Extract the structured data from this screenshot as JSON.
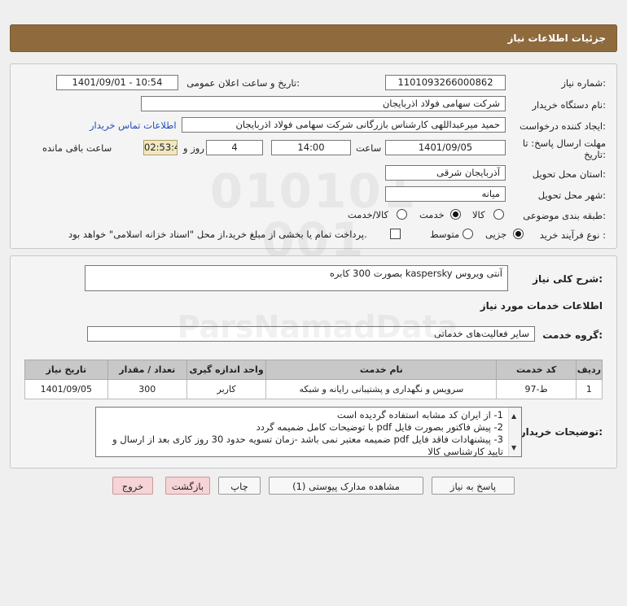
{
  "header": {
    "title": "جزئیات اطلاعات نیاز"
  },
  "form": {
    "need_number_label": "شماره نیاز:",
    "need_number": "1101093266000862",
    "announce_label": "تاریخ و ساعت اعلان عمومی:",
    "announce_value": "1401/09/01 - 10:54",
    "buyer_org_label": "نام دستگاه خریدار:",
    "buyer_org": "شرکت سهامی فولاد اذربایجان",
    "creator_label": "ایجاد کننده درخواست:",
    "creator": "حمید میرعبداللهی کارشناس بازرگانی شرکت سهامی فولاد اذربایجان",
    "contact_link": "اطلاعات تماس خریدار",
    "deadline_label_1": "مهلت ارسال پاسخ: تا",
    "deadline_label_2": "تاریخ:",
    "deadline_date": "1401/09/05",
    "time_label": "ساعت",
    "deadline_time": "14:00",
    "days_value": "4",
    "days_label": "روز و",
    "remaining_time": "02:53:45",
    "remaining_label": "ساعت باقی مانده",
    "province_label": "استان محل تحویل:",
    "province": "آذربایجان شرقی",
    "city_label": "شهر محل تحویل:",
    "city": "میانه",
    "category_label": "طبقه بندی موضوعی:",
    "category_options": [
      "کالا",
      "خدمت",
      "کالا/خدمت"
    ],
    "category_selected": "خدمت",
    "purchase_type_label": "نوع فرآیند خرید :",
    "purchase_options": [
      "جزیی",
      "متوسط"
    ],
    "purchase_selected": "جزیی",
    "treasury_note": "پرداخت تمام یا بخشی از مبلغ خرید،از محل \"اسناد خزانه اسلامی\" خواهد بود."
  },
  "summary": {
    "label": "شرح کلی نیاز:",
    "text": "آنتی ویروس kaspersky بصورت 300 کابره"
  },
  "services": {
    "section_title": "اطلاعات خدمات مورد نیاز",
    "group_label": "گروه خدمت:",
    "group_value": "سایر فعالیت‌های خدماتی",
    "columns": [
      "ردیف",
      "کد خدمت",
      "نام خدمت",
      "واحد اندازه گیری",
      "تعداد / مقدار",
      "تاریخ نیاز"
    ],
    "rows": [
      [
        "1",
        "ط-97",
        "سرویس و نگهداری و پشتیبانی رایانه و شبکه",
        "کاربر",
        "300",
        "1401/09/05"
      ]
    ]
  },
  "notes": {
    "label": "توضیحات خریدار:",
    "lines": [
      "1- از ایران کد مشابه استفاده گردیده است",
      "2- پیش فاکتور بصورت فایل pdf با توضیحات کامل ضمیمه گردد",
      "3- پیشنهادات فاقد فایل pdf  ضمیمه معتبر نمی باشد -زمان تسویه حدود 30 روز کاری بعد از ارسال و تایید کارشناسی کالا"
    ]
  },
  "buttons": {
    "reply": "پاسخ به نیاز",
    "attachments": "مشاهده مدارک پیوستی (1)",
    "print": "چاپ",
    "back": "بازگشت",
    "exit": "خروج"
  }
}
